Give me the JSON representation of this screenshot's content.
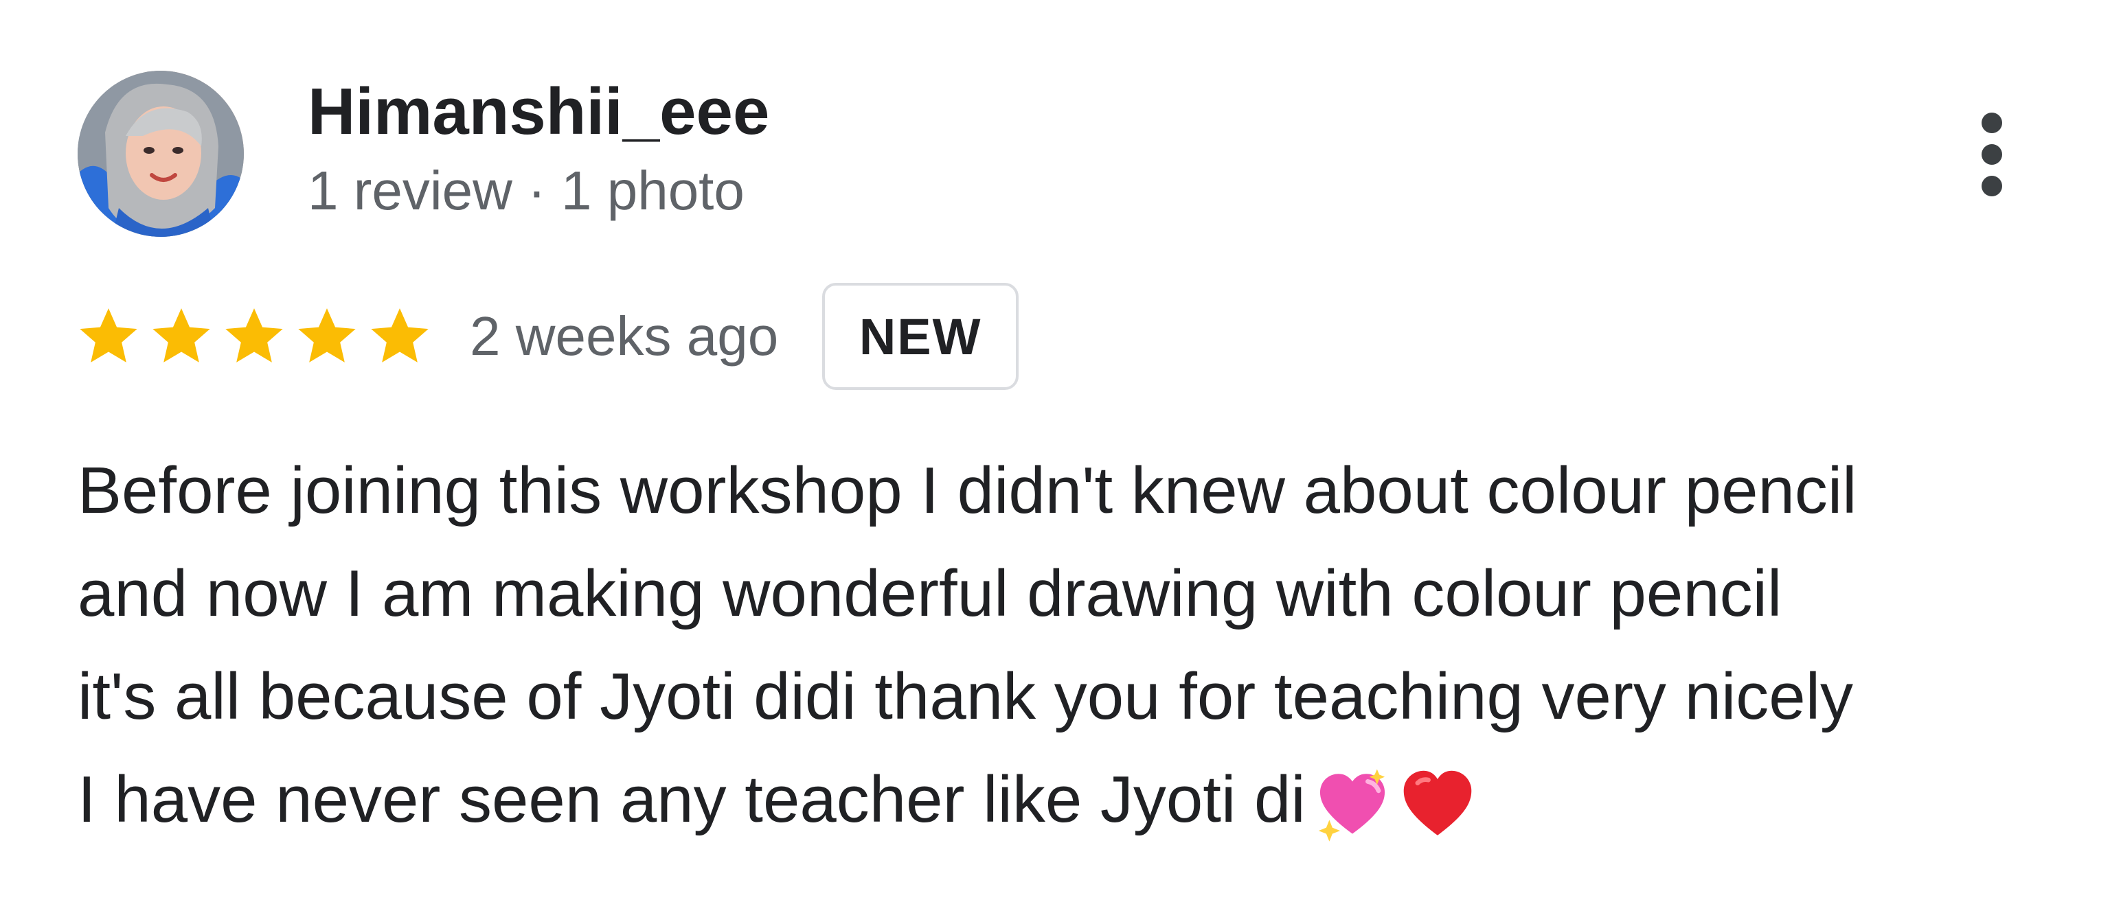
{
  "review": {
    "author": {
      "name": "Himanshii_eee",
      "meta": "1 review · 1 photo"
    },
    "rating": {
      "stars": 5,
      "max": 5,
      "star_color": "#fbbc04"
    },
    "time_ago": "2 weeks ago",
    "badge": "NEW",
    "text_lines": [
      "Before joining this workshop I didn't knew about colour pencil",
      "and now I am making wonderful drawing with colour pencil",
      "it's all because of Jyoti didi thank you for teaching very nicely",
      "I have never seen any teacher like Jyoti di"
    ],
    "emojis": [
      "sparkling-heart",
      "red-heart"
    ],
    "more_icon": "more-vert-icon"
  }
}
